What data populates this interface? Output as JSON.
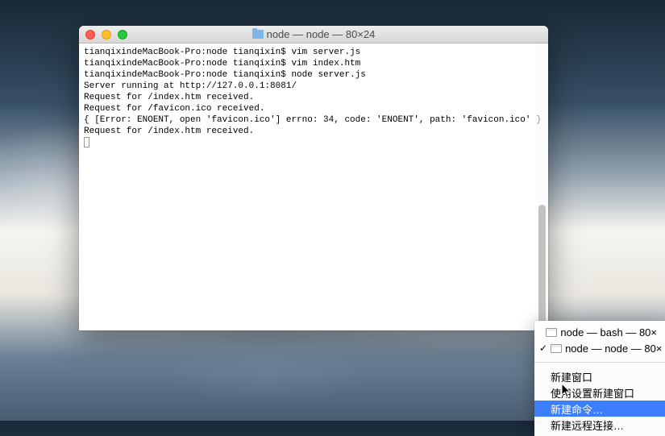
{
  "window": {
    "title": "node — node — 80×24"
  },
  "terminal": {
    "lines": [
      "tianqixindeMacBook-Pro:node tianqixin$ vim server.js",
      "tianqixindeMacBook-Pro:node tianqixin$ vim index.htm",
      "tianqixindeMacBook-Pro:node tianqixin$ node server.js",
      "Server running at http://127.0.0.1:8081/",
      "Request for /index.htm received.",
      "Request for /favicon.ico received.",
      "{ [Error: ENOENT, open 'favicon.ico'] errno: 34, code: 'ENOENT', path: 'favicon.ico' }",
      "Request for /index.htm received."
    ]
  },
  "context_menu": {
    "tabs": [
      {
        "label": "node — bash — 80×",
        "checked": false
      },
      {
        "label": "node — node — 80×",
        "checked": true
      }
    ],
    "items": [
      {
        "label": "新建窗口",
        "highlight": false
      },
      {
        "label": "使用设置新建窗口",
        "highlight": false
      },
      {
        "label": "新建命令…",
        "highlight": true
      },
      {
        "label": "新建远程连接…",
        "highlight": false
      }
    ]
  }
}
